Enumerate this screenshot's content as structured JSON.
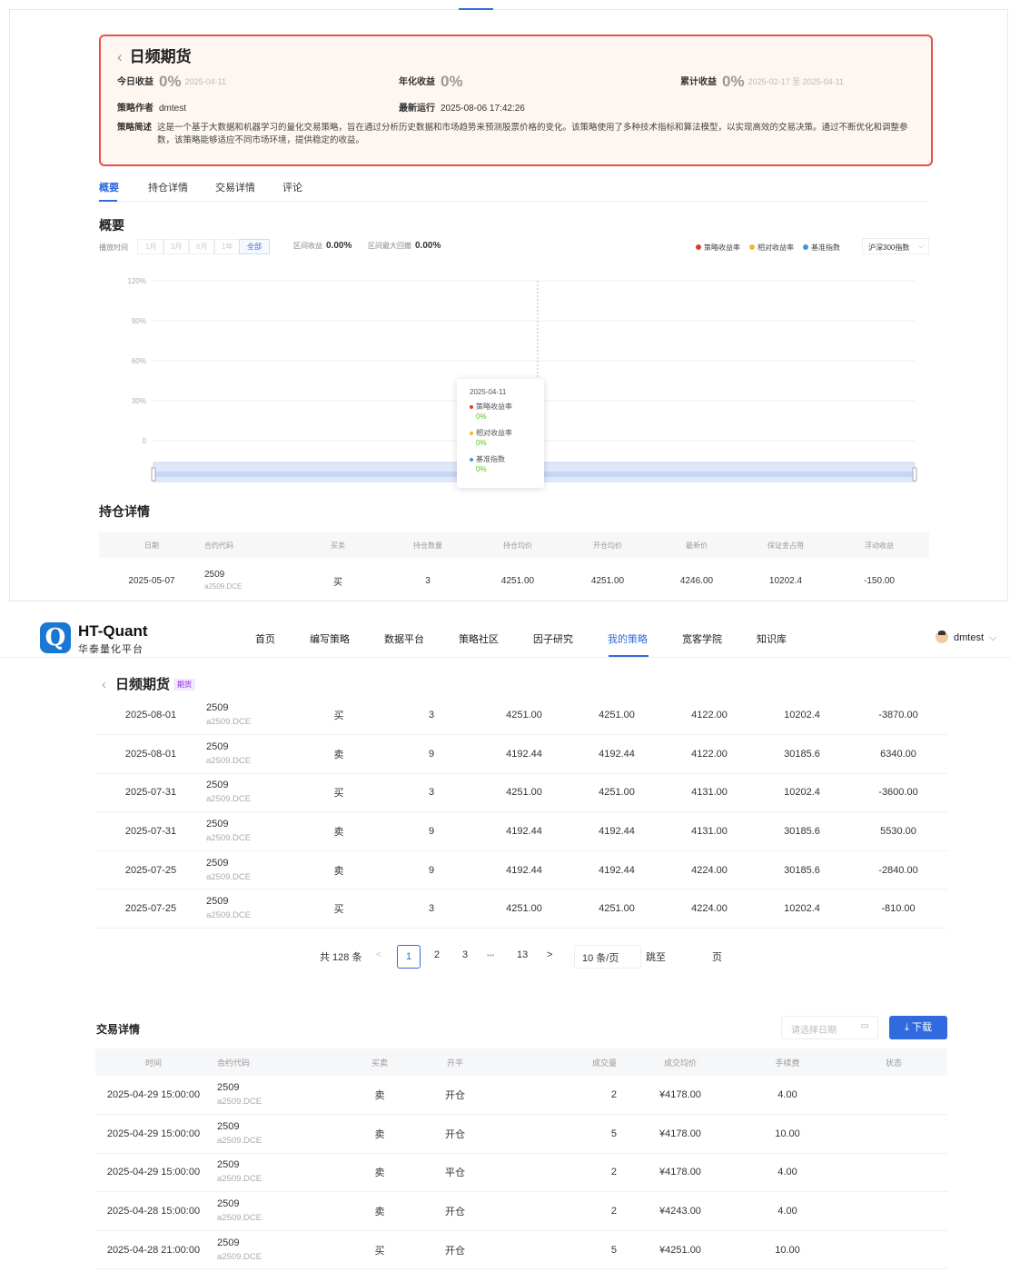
{
  "top": {
    "title": "日频期货",
    "back_icon": "‹",
    "today_label": "今日收益",
    "today_value": "0%",
    "today_date": "2025-04-11",
    "annual_label": "年化收益",
    "annual_value": "0%",
    "cumulative_label": "累计收益",
    "cumulative_value": "0%",
    "cumulative_range": "2025-02-17 至 2025-04-11",
    "author_label": "策略作者",
    "author_value": "dmtest",
    "last_run_label": "最新运行",
    "last_run_value": "2025-08-06 17:42:26",
    "desc_label": "策略简述",
    "desc_text": "这是一个基于大数据和机器学习的量化交易策略，旨在通过分析历史数据和市场趋势来预测股票价格的变化。该策略使用了多种技术指标和算法模型，以实现高效的交易决策。通过不断优化和调整参数，该策略能够适应不同市场环境，提供稳定的收益。",
    "tabs": [
      "概要",
      "持仓详情",
      "交易详情",
      "评论"
    ],
    "overview_title": "概要",
    "range_label": "播放时间",
    "range_buttons": [
      "1月",
      "3月",
      "6月",
      "1年",
      "全部"
    ],
    "interval_return_label": "区间收益",
    "interval_return_value": "0.00%",
    "max_drawdown_label": "区间最大回撤",
    "max_drawdown_value": "0.00%",
    "legend": [
      {
        "name": "策略收益率",
        "color": "#e03c31"
      },
      {
        "name": "相对收益率",
        "color": "#f5b82e"
      },
      {
        "name": "基准指数",
        "color": "#4a90e2"
      }
    ],
    "index_select": "沪深300指数",
    "tooltip": {
      "date": "2025-04-11",
      "items": [
        {
          "name": "策略收益率",
          "value": "0%",
          "color": "#e03c31"
        },
        {
          "name": "相对收益率",
          "value": "0%",
          "color": "#f5b82e"
        },
        {
          "name": "基准指数",
          "value": "0%",
          "color": "#4a90e2"
        }
      ]
    },
    "positions_title": "持仓详情",
    "positions_headers": [
      "日期",
      "合约代码",
      "买卖",
      "持仓数量",
      "持仓均价",
      "开仓均价",
      "最新价",
      "保证金占用",
      "浮动收益"
    ],
    "positions_rows": [
      {
        "date": "2025-05-07",
        "code": "2509",
        "sub": "a2509.DCE",
        "side": "买",
        "qty": "3",
        "hold_avg": "4251.00",
        "open_avg": "4251.00",
        "last": "4246.00",
        "margin": "10202.4",
        "pnl": "-150.00"
      }
    ]
  },
  "chart_data": {
    "type": "line",
    "title": "",
    "xlabel": "",
    "ylabel": "",
    "y_ticks": [
      "120%",
      "90%",
      "60%",
      "30%",
      "0"
    ],
    "ylim": [
      0,
      120
    ],
    "x": [
      "2025-04-11"
    ],
    "series": [
      {
        "name": "策略收益率",
        "values": [
          0
        ]
      },
      {
        "name": "相对收益率",
        "values": [
          0
        ]
      },
      {
        "name": "基准指数",
        "values": [
          0
        ]
      }
    ]
  },
  "nav": {
    "brand": "HT-Quant",
    "brand_sub": "华泰量化平台",
    "logo_letter": "Q",
    "items": [
      "首页",
      "编写策略",
      "数据平台",
      "策略社区",
      "因子研究",
      "我的策略",
      "宽客学院",
      "知识库"
    ],
    "user": "dmtest"
  },
  "bottom": {
    "title": "日频期货",
    "tag": "期货",
    "positions_rows": [
      {
        "date": "2025-08-01",
        "code": "2509",
        "sub": "a2509.DCE",
        "side": "买",
        "qty": "3",
        "hold_avg": "4251.00",
        "open_avg": "4251.00",
        "last": "4122.00",
        "margin": "10202.4",
        "pnl": "-3870.00"
      },
      {
        "date": "2025-08-01",
        "code": "2509",
        "sub": "a2509.DCE",
        "side": "卖",
        "qty": "9",
        "hold_avg": "4192.44",
        "open_avg": "4192.44",
        "last": "4122.00",
        "margin": "30185.6",
        "pnl": "6340.00"
      },
      {
        "date": "2025-07-31",
        "code": "2509",
        "sub": "a2509.DCE",
        "side": "买",
        "qty": "3",
        "hold_avg": "4251.00",
        "open_avg": "4251.00",
        "last": "4131.00",
        "margin": "10202.4",
        "pnl": "-3600.00"
      },
      {
        "date": "2025-07-31",
        "code": "2509",
        "sub": "a2509.DCE",
        "side": "卖",
        "qty": "9",
        "hold_avg": "4192.44",
        "open_avg": "4192.44",
        "last": "4131.00",
        "margin": "30185.6",
        "pnl": "5530.00"
      },
      {
        "date": "2025-07-25",
        "code": "2509",
        "sub": "a2509.DCE",
        "side": "卖",
        "qty": "9",
        "hold_avg": "4192.44",
        "open_avg": "4192.44",
        "last": "4224.00",
        "margin": "30185.6",
        "pnl": "-2840.00"
      },
      {
        "date": "2025-07-25",
        "code": "2509",
        "sub": "a2509.DCE",
        "side": "买",
        "qty": "3",
        "hold_avg": "4251.00",
        "open_avg": "4251.00",
        "last": "4224.00",
        "margin": "10202.4",
        "pnl": "-810.00"
      }
    ],
    "pager": {
      "total": "共 128 条",
      "pages": [
        "1",
        "2",
        "3",
        "•••",
        "13"
      ],
      "size": "10 条/页",
      "jump_label": "跳至",
      "page_suffix": "页"
    },
    "trades_title": "交易详情",
    "date_placeholder": "请选择日期",
    "download": "下载",
    "trades_headers": [
      "时间",
      "合约代码",
      "买卖",
      "开平",
      "成交量",
      "成交均价",
      "手续费",
      "状态"
    ],
    "trades_rows": [
      {
        "time": "2025-04-29 15:00:00",
        "code": "2509",
        "sub": "a2509.DCE",
        "side": "卖",
        "oc": "开仓",
        "vol": "2",
        "price": "¥4178.00",
        "fee": "4.00",
        "status": ""
      },
      {
        "time": "2025-04-29 15:00:00",
        "code": "2509",
        "sub": "a2509.DCE",
        "side": "卖",
        "oc": "开仓",
        "vol": "5",
        "price": "¥4178.00",
        "fee": "10.00",
        "status": ""
      },
      {
        "time": "2025-04-29 15:00:00",
        "code": "2509",
        "sub": "a2509.DCE",
        "side": "卖",
        "oc": "平仓",
        "vol": "2",
        "price": "¥4178.00",
        "fee": "4.00",
        "status": ""
      },
      {
        "time": "2025-04-28 15:00:00",
        "code": "2509",
        "sub": "a2509.DCE",
        "side": "卖",
        "oc": "开仓",
        "vol": "2",
        "price": "¥4243.00",
        "fee": "4.00",
        "status": ""
      },
      {
        "time": "2025-04-28 21:00:00",
        "code": "2509",
        "sub": "a2509.DCE",
        "side": "买",
        "oc": "开仓",
        "vol": "5",
        "price": "¥4251.00",
        "fee": "10.00",
        "status": ""
      }
    ]
  }
}
